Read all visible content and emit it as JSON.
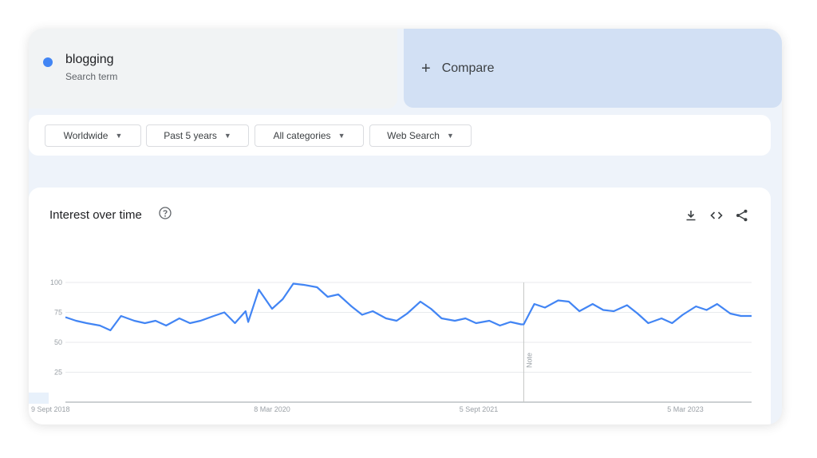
{
  "search_term": {
    "name": "blogging",
    "sub_label": "Search term",
    "color": "#4285f4"
  },
  "compare": {
    "plus": "+",
    "label": "Compare"
  },
  "filters": {
    "region": "Worldwide",
    "time": "Past 5 years",
    "category": "All categories",
    "search_type": "Web Search"
  },
  "chart_header": {
    "title": "Interest over time",
    "help_icon": "help-circle-icon"
  },
  "actions": [
    "download-icon",
    "embed-code-icon",
    "share-icon"
  ],
  "chart_data": {
    "type": "line",
    "title": "Interest over time",
    "xlabel": "",
    "ylabel": "",
    "ylim": [
      0,
      100
    ],
    "yticks": [
      25,
      50,
      75,
      100
    ],
    "x_tick_labels": [
      {
        "label": "9 Sept 2018",
        "x": "2018-09-09"
      },
      {
        "label": "8 Mar 2020",
        "x": "2020-03-08"
      },
      {
        "label": "5 Sept 2021",
        "x": "2021-09-05"
      },
      {
        "label": "5 Mar 2023",
        "x": "2023-03-05"
      }
    ],
    "x_range": [
      "2018-09-09",
      "2023-08-27"
    ],
    "grid": true,
    "annotation": {
      "label": "Note",
      "x": "2022-01-02"
    },
    "series": [
      {
        "color": "#4285f4",
        "x": [
          "2018-09-09",
          "2018-10-07",
          "2018-11-04",
          "2018-12-09",
          "2019-01-06",
          "2019-02-03",
          "2019-03-10",
          "2019-04-07",
          "2019-05-05",
          "2019-06-02",
          "2019-07-07",
          "2019-08-04",
          "2019-09-01",
          "2019-10-06",
          "2019-11-03",
          "2019-12-01",
          "2019-12-29",
          "2020-01-05",
          "2020-02-02",
          "2020-03-08",
          "2020-04-05",
          "2020-05-03",
          "2020-05-31",
          "2020-07-05",
          "2020-08-02",
          "2020-08-30",
          "2020-10-04",
          "2020-11-01",
          "2020-11-29",
          "2021-01-03",
          "2021-01-31",
          "2021-02-28",
          "2021-04-04",
          "2021-05-02",
          "2021-05-30",
          "2021-07-04",
          "2021-08-01",
          "2021-08-29",
          "2021-10-03",
          "2021-10-31",
          "2021-11-28",
          "2021-12-26",
          "2022-01-02",
          "2022-01-30",
          "2022-02-27",
          "2022-04-03",
          "2022-05-01",
          "2022-05-29",
          "2022-07-03",
          "2022-07-31",
          "2022-08-28",
          "2022-10-02",
          "2022-10-30",
          "2022-11-27",
          "2023-01-01",
          "2023-01-29",
          "2023-02-26",
          "2023-04-02",
          "2023-04-30",
          "2023-05-28",
          "2023-07-02",
          "2023-07-30",
          "2023-08-27"
        ],
        "values": [
          71,
          68,
          66,
          64,
          60,
          72,
          68,
          66,
          68,
          64,
          70,
          66,
          68,
          72,
          75,
          66,
          76,
          67,
          94,
          78,
          86,
          99,
          98,
          96,
          88,
          90,
          80,
          73,
          76,
          70,
          68,
          74,
          84,
          78,
          70,
          68,
          70,
          66,
          68,
          64,
          67,
          65,
          65,
          82,
          79,
          85,
          84,
          76,
          82,
          77,
          76,
          81,
          74,
          66,
          70,
          66,
          73,
          80,
          77,
          82,
          74,
          72,
          72
        ]
      }
    ]
  }
}
